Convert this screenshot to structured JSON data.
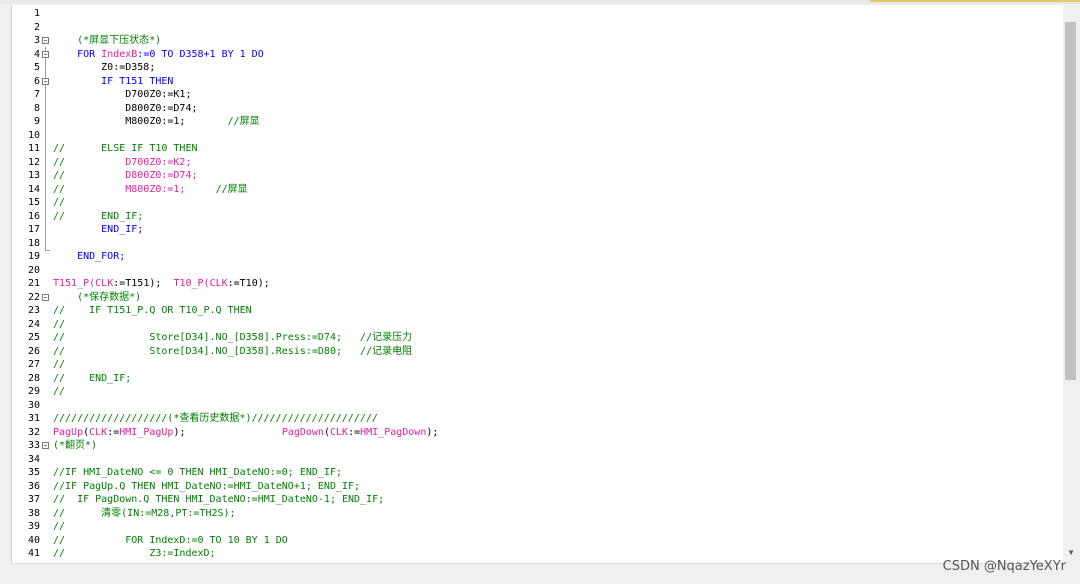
{
  "editor": {
    "lines": [
      {
        "n": "1",
        "fold": false,
        "segs": []
      },
      {
        "n": "2",
        "fold": false,
        "segs": []
      },
      {
        "n": "3",
        "fold": true,
        "segs": [
          [
            "cm",
            "    (*屏显下压状态*)"
          ]
        ]
      },
      {
        "n": "4",
        "fold": true,
        "segs": [
          [
            "kw",
            "    FOR "
          ],
          [
            "pk",
            "IndexB"
          ],
          [
            "kw",
            ":=0 TO D358+1 BY 1 DO"
          ]
        ]
      },
      {
        "n": "5",
        "fold": false,
        "segs": [
          [
            "",
            "        Z0:=D358;"
          ]
        ]
      },
      {
        "n": "6",
        "fold": true,
        "segs": [
          [
            "kw",
            "        IF T151 THEN"
          ]
        ]
      },
      {
        "n": "7",
        "fold": false,
        "segs": [
          [
            "",
            "            D700Z0:=K1;"
          ]
        ]
      },
      {
        "n": "8",
        "fold": false,
        "segs": [
          [
            "",
            "            D800Z0:=D74;"
          ]
        ]
      },
      {
        "n": "9",
        "fold": false,
        "segs": [
          [
            "",
            "            M800Z0:=1;       "
          ],
          [
            "cm",
            "//屏显"
          ]
        ]
      },
      {
        "n": "10",
        "fold": false,
        "segs": []
      },
      {
        "n": "11",
        "fold": false,
        "segs": [
          [
            "cm",
            "//      ELSE IF T10 THEN"
          ]
        ]
      },
      {
        "n": "12",
        "fold": false,
        "segs": [
          [
            "cm",
            "//          "
          ],
          [
            "pk",
            "D700Z0:=K2;"
          ]
        ]
      },
      {
        "n": "13",
        "fold": false,
        "segs": [
          [
            "cm",
            "//          "
          ],
          [
            "pk",
            "D800Z0:=D74;"
          ]
        ]
      },
      {
        "n": "14",
        "fold": false,
        "segs": [
          [
            "cm",
            "//          "
          ],
          [
            "pk",
            "M800Z0:=1;"
          ],
          [
            "cm",
            "     //屏显"
          ]
        ]
      },
      {
        "n": "15",
        "fold": false,
        "segs": [
          [
            "cm",
            "//"
          ]
        ]
      },
      {
        "n": "16",
        "fold": false,
        "segs": [
          [
            "cm",
            "//      END_IF;"
          ]
        ]
      },
      {
        "n": "17",
        "fold": false,
        "segs": [
          [
            "kw",
            "        END_IF;"
          ]
        ]
      },
      {
        "n": "18",
        "fold": false,
        "segs": []
      },
      {
        "n": "19",
        "fold": false,
        "segs": [
          [
            "kw",
            "    END_FOR;"
          ]
        ]
      },
      {
        "n": "20",
        "fold": false,
        "segs": []
      },
      {
        "n": "21",
        "fold": false,
        "segs": [
          [
            "pk",
            "T151_P("
          ],
          [
            "pk",
            "CLK"
          ],
          [
            "",
            ":=T151);  "
          ],
          [
            "pk",
            "T10_P("
          ],
          [
            "pk",
            "CLK"
          ],
          [
            "",
            ":=T10);"
          ]
        ]
      },
      {
        "n": "22",
        "fold": true,
        "segs": [
          [
            "cm",
            "    (*保存数据*)"
          ]
        ]
      },
      {
        "n": "23",
        "fold": false,
        "segs": [
          [
            "cm",
            "//    IF T151_P.Q OR T10_P.Q THEN"
          ]
        ]
      },
      {
        "n": "24",
        "fold": false,
        "segs": [
          [
            "cm",
            "//"
          ]
        ]
      },
      {
        "n": "25",
        "fold": false,
        "segs": [
          [
            "cm",
            "//              Store[D34].NO_[D358].Press:=D74;   //记录压力"
          ]
        ]
      },
      {
        "n": "26",
        "fold": false,
        "segs": [
          [
            "cm",
            "//              Store[D34].NO_[D358].Resis:=D80;   //记录电阻"
          ]
        ]
      },
      {
        "n": "27",
        "fold": false,
        "segs": [
          [
            "cm",
            "//"
          ]
        ]
      },
      {
        "n": "28",
        "fold": false,
        "segs": [
          [
            "cm",
            "//    END_IF;"
          ]
        ]
      },
      {
        "n": "29",
        "fold": false,
        "segs": [
          [
            "cm",
            "//"
          ]
        ]
      },
      {
        "n": "30",
        "fold": false,
        "segs": []
      },
      {
        "n": "31",
        "fold": false,
        "segs": [
          [
            "cm",
            "///////////////////(*查看历史数据*)/////////////////////"
          ]
        ]
      },
      {
        "n": "32",
        "fold": false,
        "segs": [
          [
            "pk",
            "PagUp"
          ],
          [
            "",
            "("
          ],
          [
            "pk",
            "CLK"
          ],
          [
            "",
            ":="
          ],
          [
            "pk",
            "HMI_PagUp"
          ],
          [
            "",
            ");"
          ],
          [
            "",
            "                "
          ],
          [
            "pk",
            "PagDown"
          ],
          [
            "",
            "("
          ],
          [
            "pk",
            "CLK"
          ],
          [
            "",
            ":="
          ],
          [
            "pk",
            "HMI_PagDown"
          ],
          [
            "",
            ");"
          ]
        ]
      },
      {
        "n": "33",
        "fold": true,
        "segs": [
          [
            "cm",
            "(*翻页*)"
          ]
        ]
      },
      {
        "n": "34",
        "fold": false,
        "segs": []
      },
      {
        "n": "35",
        "fold": false,
        "segs": [
          [
            "cm",
            "//IF HMI_DateNO <= 0 THEN HMI_DateNO:=0; END_IF;"
          ]
        ]
      },
      {
        "n": "36",
        "fold": false,
        "segs": [
          [
            "cm",
            "//IF PagUp.Q THEN HMI_DateNO:=HMI_DateNO+1; END_IF;"
          ]
        ]
      },
      {
        "n": "37",
        "fold": false,
        "segs": [
          [
            "cm",
            "//  IF PagDown.Q THEN HMI_DateNO:=HMI_DateNO-1; END_IF;"
          ]
        ]
      },
      {
        "n": "38",
        "fold": false,
        "segs": [
          [
            "cm",
            "//      清零(IN:=M28,PT:=TH2S);"
          ]
        ]
      },
      {
        "n": "39",
        "fold": false,
        "segs": [
          [
            "cm",
            "//"
          ]
        ]
      },
      {
        "n": "40",
        "fold": false,
        "segs": [
          [
            "cm",
            "//          FOR IndexD:=0 TO 10 BY 1 DO"
          ]
        ]
      },
      {
        "n": "41",
        "fold": false,
        "segs": [
          [
            "cm",
            "//              Z3:=IndexD;"
          ]
        ]
      }
    ]
  },
  "watermark": "CSDN @NqazYeXYr"
}
